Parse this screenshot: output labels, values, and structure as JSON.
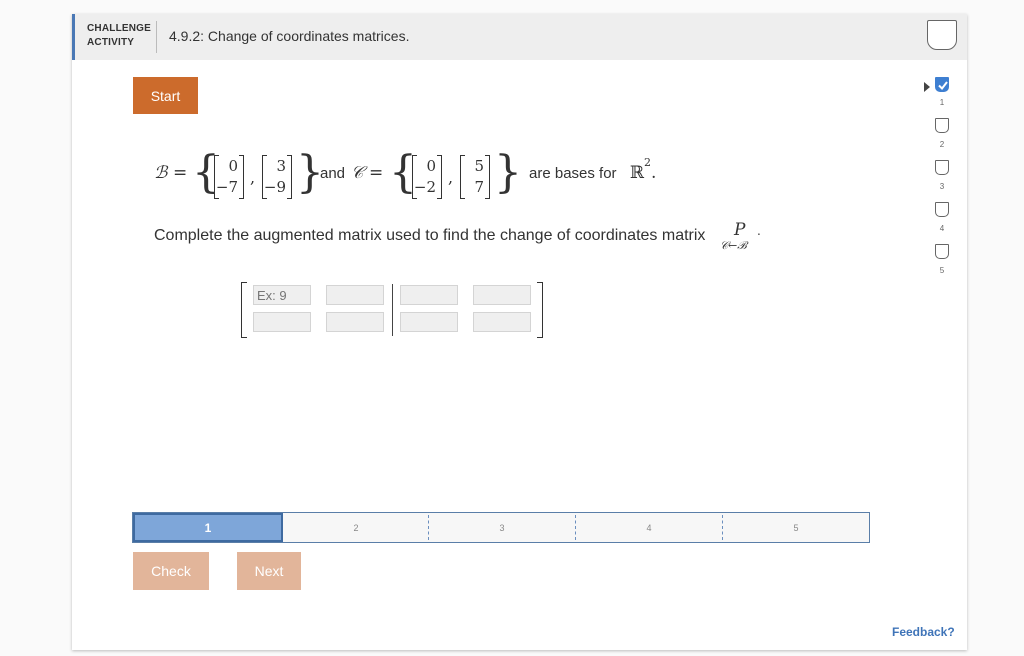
{
  "header": {
    "activity_type_line1": "CHALLENGE",
    "activity_type_line2": "ACTIVITY",
    "title": "4.9.2: Change of coordinates matrices."
  },
  "start_label": "Start",
  "problem": {
    "basis_B_symbol": "ℬ",
    "equals": "=",
    "basis_B_vectors": [
      [
        "0",
        "−7"
      ],
      [
        "3",
        "−9"
      ]
    ],
    "and_text": "and",
    "basis_C_symbol": "𝒞",
    "basis_C_vectors": [
      [
        "0",
        "−2"
      ],
      [
        "5",
        "7"
      ]
    ],
    "suffix_text": "are bases for",
    "space": "ℝ",
    "space_exp": "2",
    "period": ".",
    "instruction": "Complete the augmented matrix used to find the change of coordinates matrix",
    "matrix_symbol": "P",
    "matrix_subscript": "𝒞←ℬ",
    "matrix_period": "."
  },
  "augmented_matrix": {
    "placeholder": "Ex: 9",
    "rows": 2,
    "cols": 4
  },
  "progress": {
    "segments": [
      "1",
      "2",
      "3",
      "4",
      "5"
    ],
    "active": 1
  },
  "buttons": {
    "check": "Check",
    "next": "Next"
  },
  "feedback_label": "Feedback?",
  "levels": {
    "items": [
      {
        "label": "",
        "status": "done"
      },
      {
        "label": "1",
        "status": "todo"
      },
      {
        "label": "2",
        "status": "todo"
      },
      {
        "label": "3",
        "status": "todo"
      },
      {
        "label": "4",
        "status": "todo"
      },
      {
        "label": "5",
        "status": "todo"
      }
    ]
  },
  "icons": {
    "completion": "completion-badge-icon",
    "level_done": "checkmark-icon",
    "current_level": "current-level-arrow-icon"
  },
  "colors": {
    "accent": "#4a78b5",
    "start": "#cc6b2c",
    "disabled_button": "#e2b59a",
    "progress_active": "#7ea6d9",
    "link": "#3f74b8"
  }
}
